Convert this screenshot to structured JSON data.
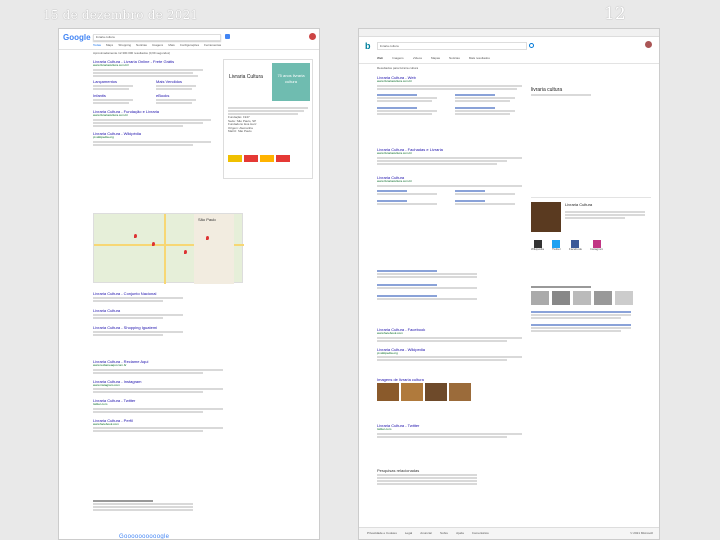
{
  "slide": {
    "date": "15 de dezembro de 2021",
    "number": "12"
  },
  "google": {
    "logo": "Google",
    "query": "livraria cultura",
    "tabs": [
      "Todas",
      "Maps",
      "Shopping",
      "Notícias",
      "Imagens",
      "Mais",
      "Configurações",
      "Ferramentas"
    ],
    "stats": "Aproximadamente 12.300.000 resultados (0,69 segundos)",
    "ad": {
      "title": "Livraria Cultura - Livraria Online - Frete Grátis",
      "url": "www.livrariacultura.com.br/"
    },
    "sitelinks": [
      "Lançamentos",
      "Mais Vendidos",
      "Infantis",
      "eBooks"
    ],
    "panel": {
      "name": "Livraria Cultura",
      "logo_text": "75 anos livraria cultura",
      "rows": [
        "Fundação: 1947",
        "Sede: São Paulo, SP",
        "Fundadora: Eva Herz",
        "Origem: Alemanha",
        "Matriz: São Paulo"
      ]
    },
    "results": [
      {
        "title": "Livraria Cultura - Fundação e Livraria",
        "url": "www.livrariacultura.com.br"
      },
      {
        "title": "Livraria Cultura - Wikipédia",
        "url": "pt.wikipedia.org"
      },
      {
        "title": "Livraria Cultura - Reclame Aqui",
        "url": "www.reclameaqui.com.br"
      },
      {
        "title": "Livraria Cultura - Instagram",
        "url": "www.instagram.com"
      },
      {
        "title": "Livraria Cultura - Twitter",
        "url": "twitter.com"
      },
      {
        "title": "Livraria Cultura - Perfil",
        "url": "www.facebook.com"
      }
    ],
    "local": [
      "Livraria Cultura - Conjunto Nacional",
      "Livraria Cultura",
      "Livraria Cultura - Shopping Iguatemi"
    ],
    "pagination": "Goooooooooogle",
    "map_label": "São Paulo"
  },
  "bing": {
    "logo": "b",
    "query": "livraria cultura",
    "tabs": [
      "Web",
      "Imagens",
      "Vídeos",
      "Mapas",
      "Notícias",
      "Mais resultados"
    ],
    "stats": "Resultados para livraria cultura",
    "top": {
      "title": "Livraria Cultura - Web",
      "url": "www.livrariacultura.com.br"
    },
    "results": [
      {
        "title": "Livraria Cultura - Fachadas e Livraria",
        "url": "www.livrariacultura.com.br"
      },
      {
        "title": "Livraria Cultura",
        "url": "www.livrariacultura.com.br"
      },
      {
        "title": "Livraria Cultura - Wikipedia",
        "url": "pt.wikipedia.org"
      },
      {
        "title": "Livraria Cultura - Facebook",
        "url": "www.facebook.com"
      },
      {
        "title": "Livraria Cultura - Twitter",
        "url": "twitter.com"
      }
    ],
    "images_label": "Imagens de livraria cultura",
    "panel_title": "livraria cultura",
    "panel_brand": "Livraria Cultura",
    "social": [
      "Wikipédia",
      "Twitter",
      "Facebook",
      "Instagram"
    ],
    "related_title": "Pesquisas relacionadas",
    "footer": [
      "Privacidade e Cookies",
      "Legal",
      "Anunciar",
      "Sobre",
      "Ajuda",
      "Comentários",
      "© 2021 Microsoft"
    ]
  }
}
